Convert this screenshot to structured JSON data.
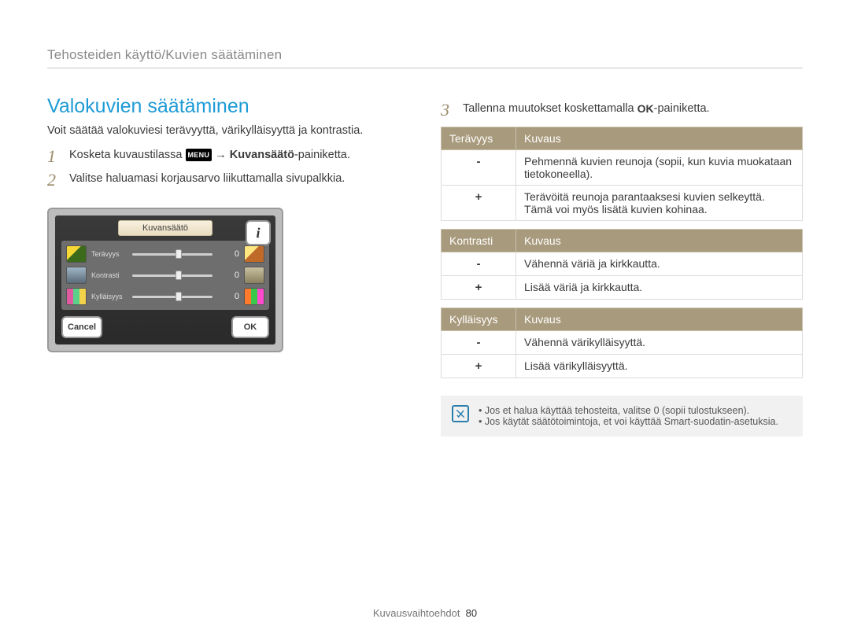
{
  "breadcrumb": "Tehosteiden käyttö/Kuvien säätäminen",
  "heading": "Valokuvien säätäminen",
  "intro": "Voit säätää valokuviesi terävyyttä, värikylläisyyttä ja kontrastia.",
  "steps": {
    "s1": {
      "num": "1",
      "pre": "Kosketa kuvaustilassa ",
      "chip": "MENU",
      "mid": " → ",
      "bold": "Kuvansäätö",
      "post": "-painiketta."
    },
    "s2": {
      "num": "2",
      "text": "Valitse haluamasi korjausarvo liikuttamalla sivupalkkia."
    },
    "s3": {
      "num": "3",
      "pre": "Tallenna muutokset koskettamalla ",
      "ok": "OK",
      "post": "-painiketta."
    }
  },
  "device": {
    "title": "Kuvansäätö",
    "rows": [
      {
        "label": "Terävyys",
        "value": "0"
      },
      {
        "label": "Kontrasti",
        "value": "0"
      },
      {
        "label": "Kylläisyys",
        "value": "0"
      }
    ],
    "info": "i",
    "cancel": "Cancel",
    "ok": "OK"
  },
  "tables": {
    "t1": {
      "h1": "Terävyys",
      "h2": "Kuvaus",
      "r": [
        {
          "sign": "-",
          "text": "Pehmennä kuvien reunoja (sopii, kun kuvia muokataan tietokoneella)."
        },
        {
          "sign": "+",
          "text": "Terävöitä reunoja parantaaksesi kuvien selkeyttä. Tämä voi myös lisätä kuvien kohinaa."
        }
      ]
    },
    "t2": {
      "h1": "Kontrasti",
      "h2": "Kuvaus",
      "r": [
        {
          "sign": "-",
          "text": "Vähennä väriä ja kirkkautta."
        },
        {
          "sign": "+",
          "text": "Lisää väriä ja kirkkautta."
        }
      ]
    },
    "t3": {
      "h1": "Kylläisyys",
      "h2": "Kuvaus",
      "r": [
        {
          "sign": "-",
          "text": "Vähennä värikylläisyyttä."
        },
        {
          "sign": "+",
          "text": "Lisää värikylläisyyttä."
        }
      ]
    }
  },
  "notes": [
    "Jos et halua käyttää tehosteita, valitse 0 (sopii tulostukseen).",
    "Jos käytät säätötoimintoja, et voi käyttää Smart-suodatin-asetuksia."
  ],
  "footer": {
    "section": "Kuvausvaihtoehdot",
    "page": "80"
  }
}
